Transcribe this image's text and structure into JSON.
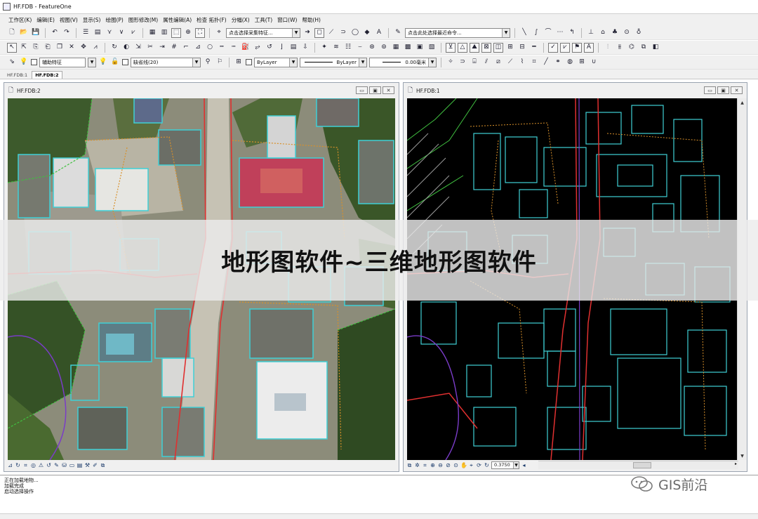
{
  "window": {
    "title": "HF.FDB - FeatureOne"
  },
  "menu": [
    "工作区(K)",
    "编辑(E)",
    "视图(V)",
    "显示(S)",
    "绘图(P)",
    "图形修改(M)",
    "属性编辑(A)",
    "检查 拓扑(F)",
    "分幅(X)",
    "工具(T)",
    "窗口(W)",
    "帮助(H)"
  ],
  "toolbar1": {
    "feature_combo": "点击选择采集特征...",
    "command_combo": "点击此处选择最近命令..."
  },
  "toolbar3": {
    "layer_combo": "辅助特征",
    "linetype_combo": "缺省线(20)",
    "color_combo": "ByLayer",
    "linestyle_combo": "ByLayer",
    "width_combo": "0.00毫米"
  },
  "doc_tabs": [
    "HF.FDB:1",
    "HF.FDB:2"
  ],
  "active_tab": "HF.FDB:2",
  "left_window": {
    "title": "HF.FDB:2",
    "view": "aerial imagery with vector overlay"
  },
  "right_window": {
    "title": "HF.FDB:1",
    "view": "vector map on black background",
    "zoom": "0.3750"
  },
  "console": {
    "lines": [
      "正在加载地物...",
      "加载完成",
      "启动选择操作"
    ]
  },
  "banner": {
    "text": "地形图软件~三维地形图软件"
  },
  "watermark": {
    "text": "GIS前沿"
  },
  "colors": {
    "ui_bg": "#f0f0f0",
    "map_black": "#000000",
    "overlay_cyan": "#3fd0d6",
    "overlay_red": "#e03030",
    "overlay_orange": "#d8902a",
    "overlay_green": "#40c040",
    "overlay_purple": "#7a3cc8"
  }
}
